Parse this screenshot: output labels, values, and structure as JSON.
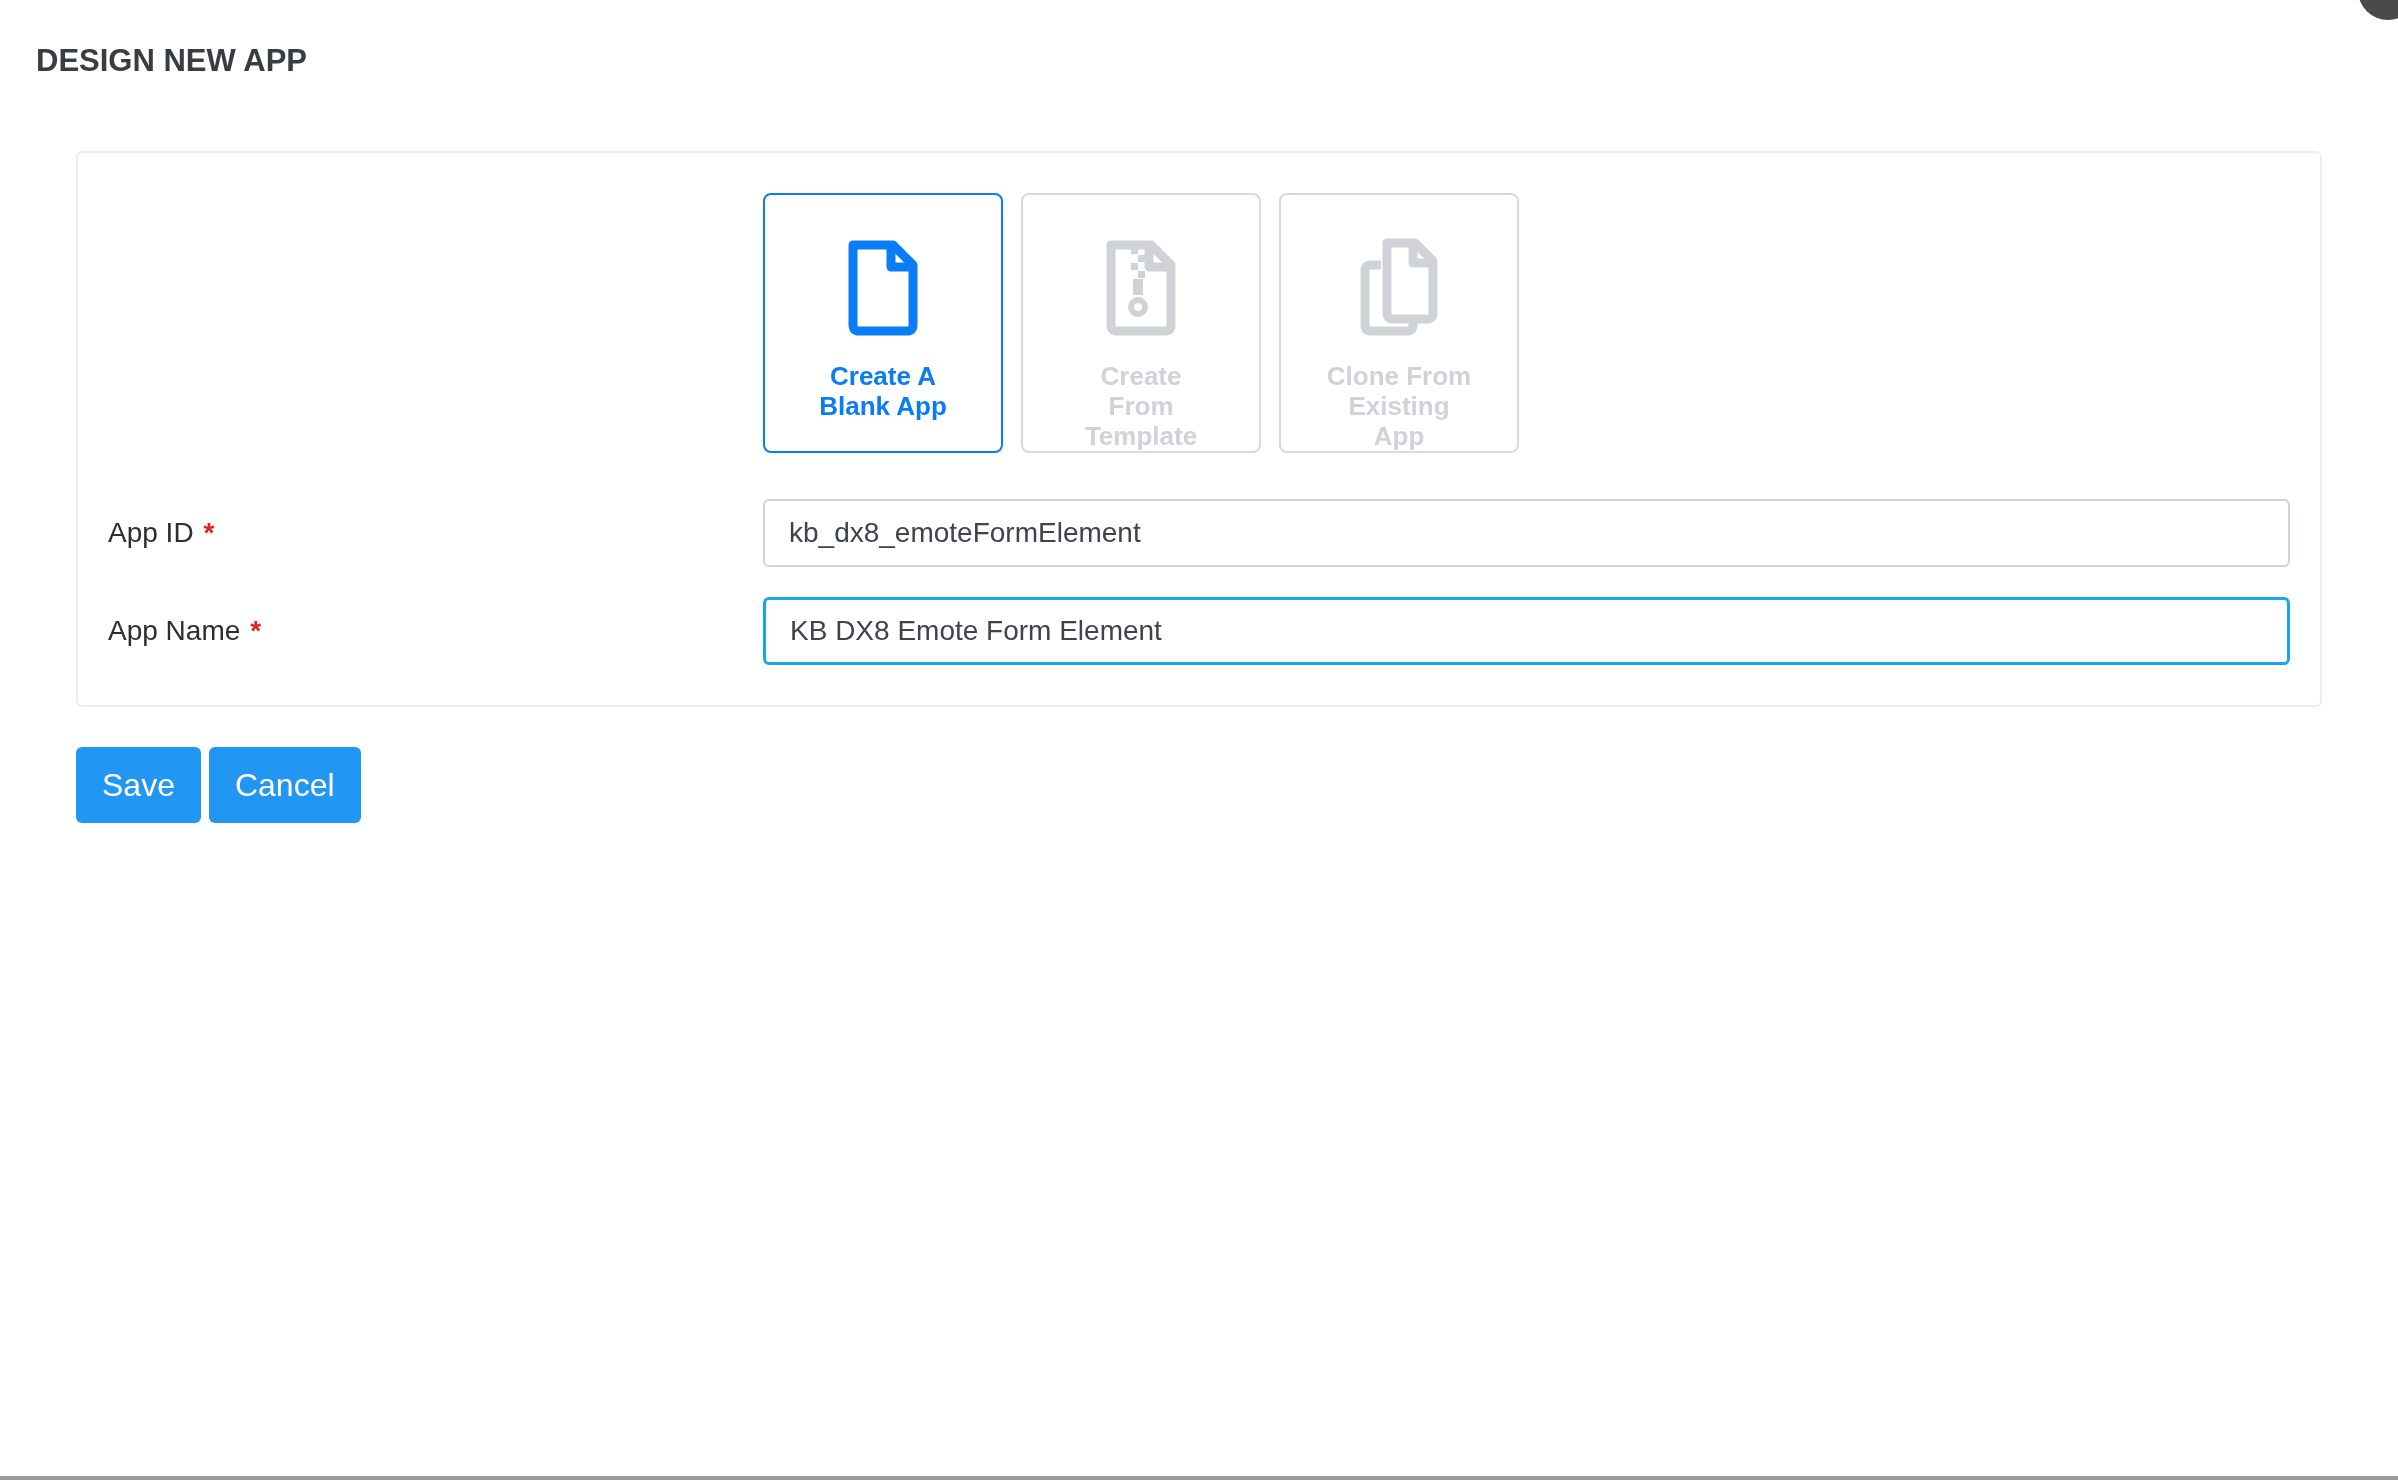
{
  "title": "DESIGN NEW APP",
  "options": [
    {
      "kind": "blank",
      "label": "Create A Blank App",
      "selected": true
    },
    {
      "kind": "template",
      "label": "Create From Template",
      "selected": false
    },
    {
      "kind": "clone",
      "label": "Clone From Existing App",
      "selected": false
    }
  ],
  "fields": [
    {
      "label": "App ID",
      "required": true,
      "value": "kb_dx8_emoteFormElement",
      "focused": false
    },
    {
      "label": "App Name",
      "required": true,
      "value": "KB DX8 Emote Form Element",
      "focused": true
    }
  ],
  "required_mark": "*",
  "buttons": [
    "Save",
    "Cancel"
  ]
}
